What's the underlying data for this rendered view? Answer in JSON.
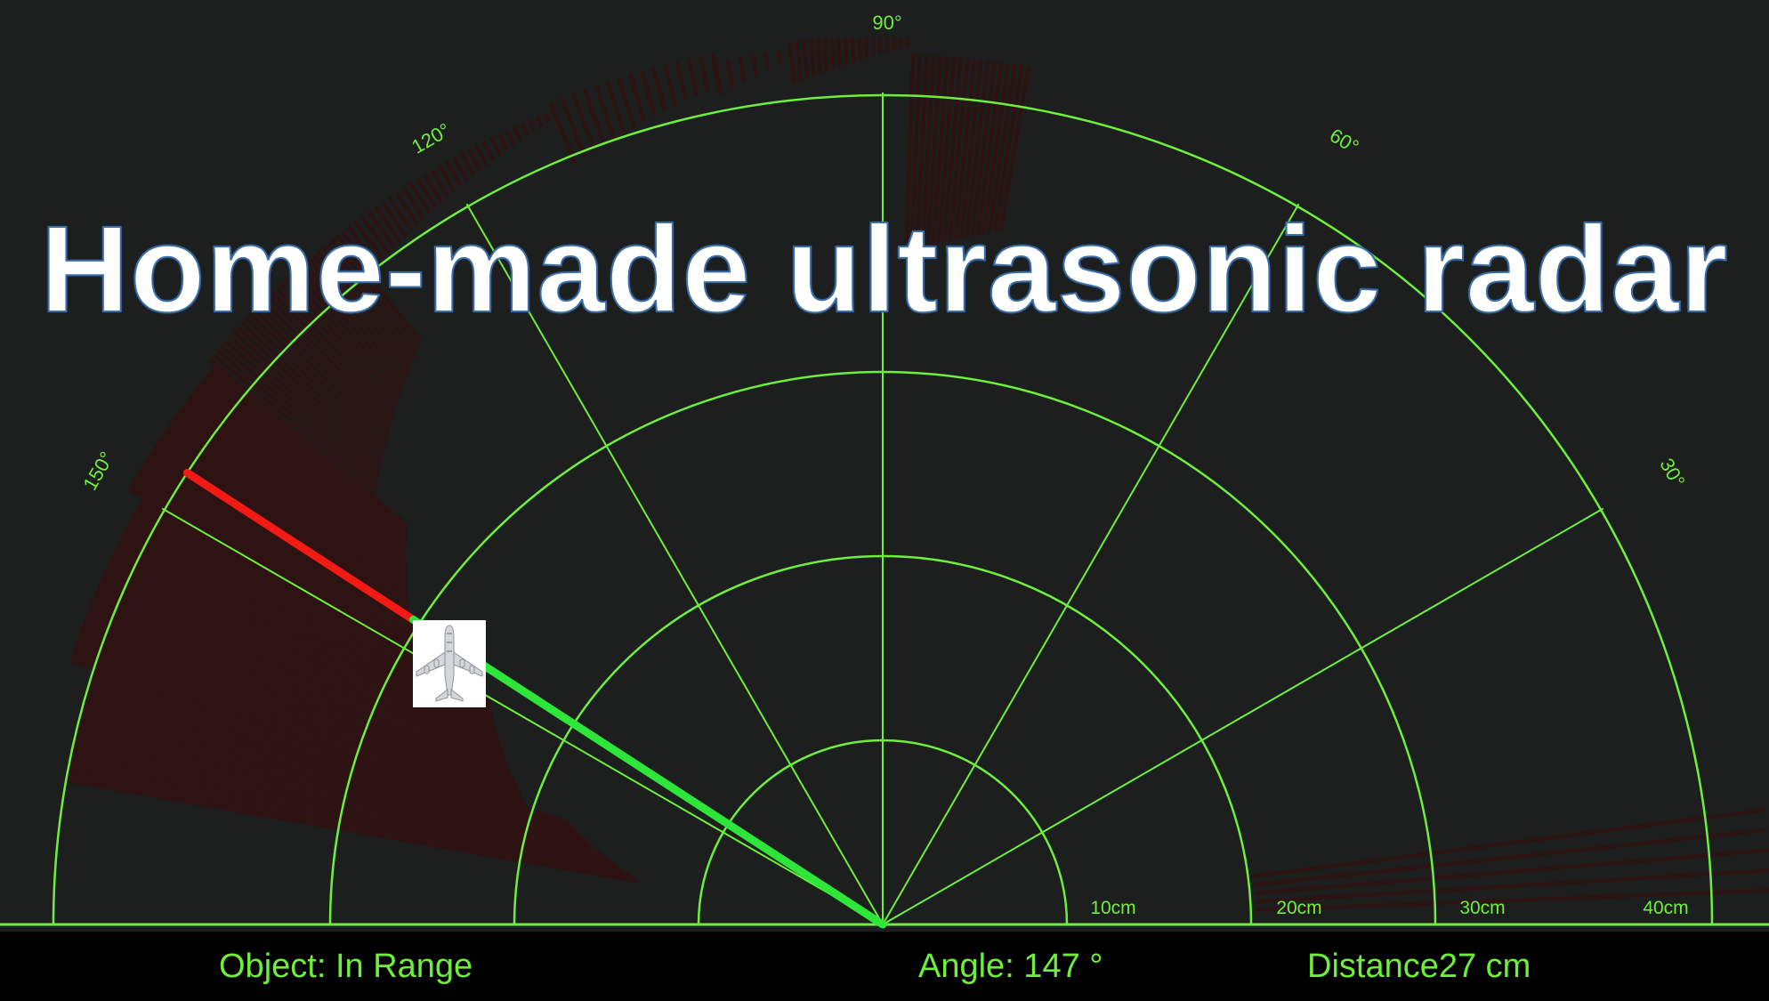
{
  "title": "Home-made ultrasonic radar",
  "angle_labels": [
    "30°",
    "60°",
    "90°",
    "120°",
    "150°"
  ],
  "range_labels": [
    "10cm",
    "20cm",
    "30cm",
    "40cm"
  ],
  "status": {
    "object": "Object: In Range",
    "angle": "Angle: 147 °",
    "distance": "Distance27 cm"
  },
  "sweep": {
    "angle_deg": 147,
    "distance_cm": 27,
    "max_range_cm": 40
  },
  "target_icon": "airplane-icon",
  "colors": {
    "grid": "#6ef03a",
    "sweep": "#2ee53a",
    "detection": "#f11a14",
    "history": "#2e1313",
    "background": "#1d1e1e",
    "status_bar": "#000000"
  }
}
